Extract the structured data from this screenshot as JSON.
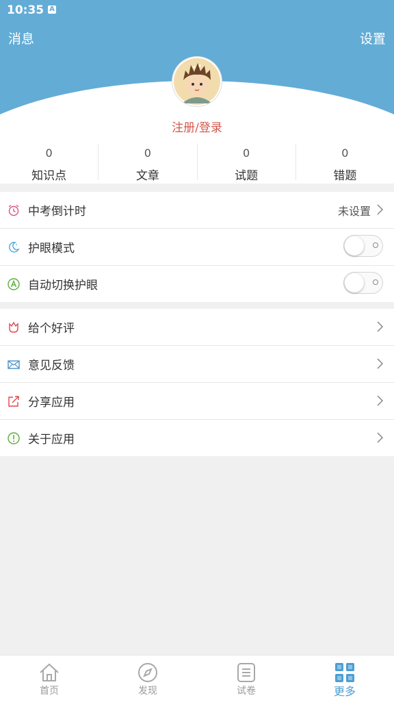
{
  "status_bar": {
    "time": "10:35",
    "notification_icon": "a-icon"
  },
  "header": {
    "left": "消息",
    "right": "设置"
  },
  "profile": {
    "avatar": "cartoon-boy-avatar",
    "login": "注册/登录"
  },
  "stats": [
    {
      "value": "0",
      "label": "知识点"
    },
    {
      "value": "0",
      "label": "文章"
    },
    {
      "value": "0",
      "label": "试题"
    },
    {
      "value": "0",
      "label": "错题"
    }
  ],
  "settings": [
    {
      "label": "中考倒计时",
      "value": "未设置",
      "icon": "alarm-clock-icon"
    },
    {
      "label": "护眼模式",
      "icon": "moon-icon",
      "toggle": false
    },
    {
      "label": "自动切换护眼",
      "icon": "auto-a-icon",
      "toggle": false
    }
  ],
  "misc": [
    {
      "label": "给个好评",
      "icon": "flower-icon"
    },
    {
      "label": "意见反馈",
      "icon": "envelope-icon"
    },
    {
      "label": "分享应用",
      "icon": "share-icon"
    },
    {
      "label": "关于应用",
      "icon": "info-icon"
    }
  ],
  "tabs": [
    {
      "label": "首页",
      "icon": "home-icon"
    },
    {
      "label": "发现",
      "icon": "compass-icon"
    },
    {
      "label": "试卷",
      "icon": "paper-list-icon"
    },
    {
      "label": "更多",
      "icon": "grid-icon",
      "active": true
    }
  ],
  "colors": {
    "header": "#63acd6",
    "accent": "#4d9ed1",
    "login": "#d4574b"
  }
}
